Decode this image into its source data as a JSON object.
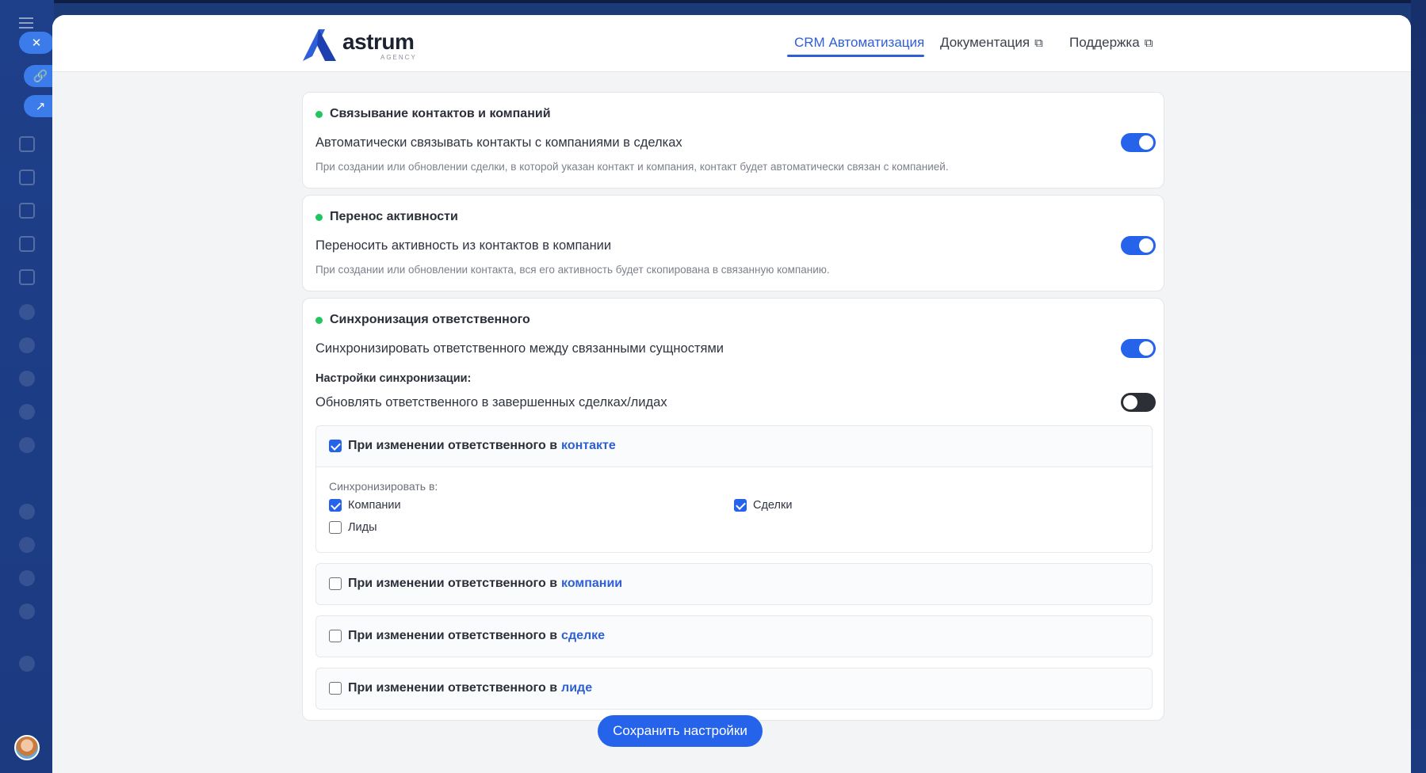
{
  "header": {
    "logo_text": "astrum",
    "logo_sub": "AGENCY",
    "nav": [
      {
        "label": "CRM Автоматизация",
        "active": true
      },
      {
        "label": "Документация",
        "external": true
      },
      {
        "label": "Поддержка",
        "external": true
      }
    ]
  },
  "sections": {
    "link": {
      "title": "Связывание контактов и компаний",
      "label": "Автоматически связывать контакты с компаниями в сделках",
      "description": "При создании или обновлении сделки, в которой указан контакт и компания, контакт будет автоматически связан с компанией.",
      "enabled": true
    },
    "activity": {
      "title": "Перенос активности",
      "label": "Переносить активность из контактов в компании",
      "description": "При создании или обновлении контакта, вся его активность будет скопирована в связанную компанию.",
      "enabled": true
    },
    "sync": {
      "title": "Синхронизация ответственного",
      "label": "Синхронизировать ответственного между связанными сущностями",
      "enabled": true,
      "settings_heading": "Настройки синхронизации:",
      "closed_label": "Обновлять ответственного в завершенных сделках/лидах",
      "closed_enabled": false,
      "prefix": "При изменении ответственного в",
      "sync_to_label": "Синхронизировать в:",
      "panels": [
        {
          "entity": "контакте",
          "checked": true
        },
        {
          "entity": "компании",
          "checked": false
        },
        {
          "entity": "сделке",
          "checked": false
        },
        {
          "entity": "лиде",
          "checked": false
        }
      ],
      "targets": [
        {
          "label": "Компании",
          "checked": true
        },
        {
          "label": "Сделки",
          "checked": true
        },
        {
          "label": "Лиды",
          "checked": false
        }
      ]
    }
  },
  "save_label": "Сохранить настройки",
  "colors": {
    "accent": "#2563eb",
    "status_dot": "#22c55e",
    "toggle_off": "#2c2f36"
  }
}
